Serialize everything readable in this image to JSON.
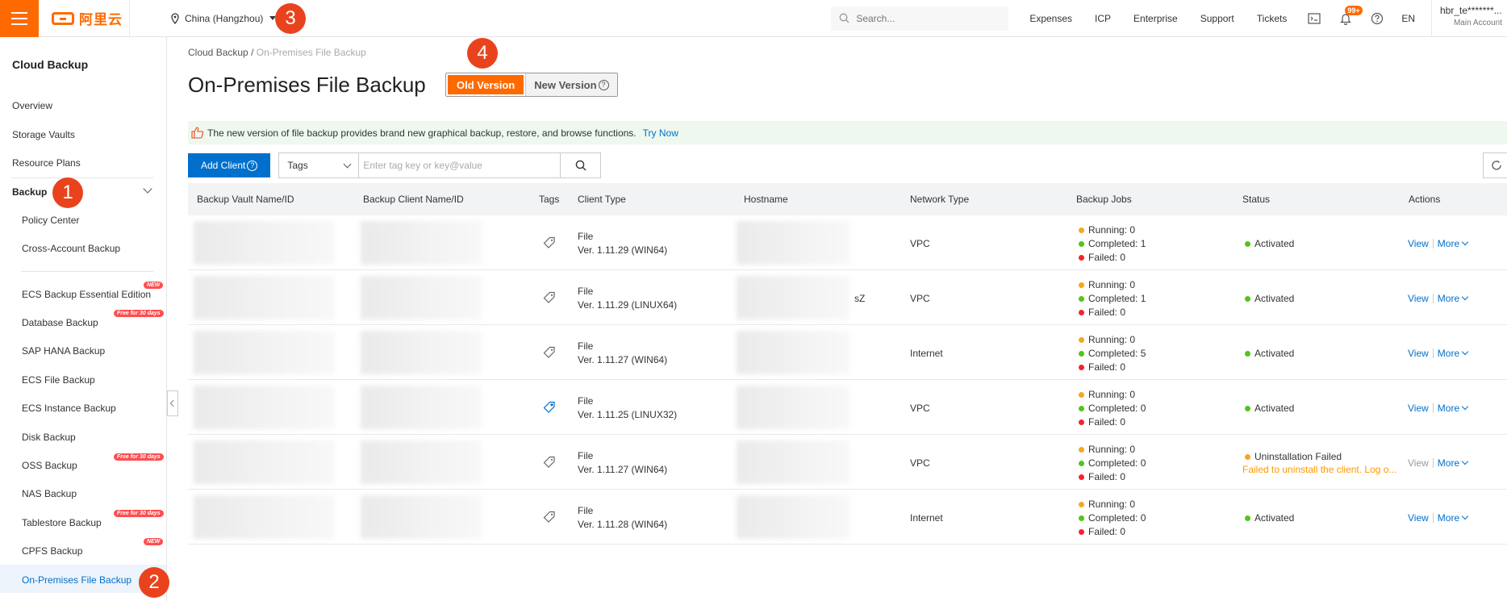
{
  "topbar": {
    "logo_text": "阿里云",
    "region": "China (Hangzhou)",
    "search_placeholder": "Search...",
    "links": [
      "Expenses",
      "ICP",
      "Enterprise",
      "Support",
      "Tickets"
    ],
    "notification_badge": "99+",
    "language": "EN",
    "account_name": "hbr_te*******...",
    "account_type": "Main Account"
  },
  "sidebar": {
    "title": "Cloud Backup",
    "items_top": [
      "Overview",
      "Storage Vaults",
      "Resource Plans"
    ],
    "backup_group": "Backup",
    "backup_sub": [
      "Policy Center",
      "Cross-Account Backup"
    ],
    "products": [
      {
        "label": "ECS Backup Essential Edition",
        "badge": "NEW"
      },
      {
        "label": "Database Backup",
        "badge": "Free for 30 days"
      },
      {
        "label": "SAP HANA Backup",
        "badge": ""
      },
      {
        "label": "ECS File Backup",
        "badge": ""
      },
      {
        "label": "ECS Instance Backup",
        "badge": ""
      },
      {
        "label": "Disk Backup",
        "badge": ""
      },
      {
        "label": "OSS Backup",
        "badge": "Free for 30 days"
      },
      {
        "label": "NAS Backup",
        "badge": ""
      },
      {
        "label": "Tablestore Backup",
        "badge": "Free for 30 days"
      },
      {
        "label": "CPFS Backup",
        "badge": "NEW"
      },
      {
        "label": "On-Premises File Backup",
        "badge": ""
      }
    ],
    "active": "On-Premises File Backup"
  },
  "steps": [
    "1",
    "2",
    "3",
    "4"
  ],
  "main": {
    "breadcrumb_root": "Cloud Backup",
    "breadcrumb_sep": "/",
    "breadcrumb_current": "On-Premises File Backup",
    "title": "On-Premises File Backup",
    "old_version": "Old Version",
    "new_version": "New Version",
    "notice": "The new version of file backup provides brand new graphical backup, restore, and browse functions.",
    "notice_link": "Try Now",
    "add_client": "Add Client",
    "tags_label": "Tags",
    "tag_placeholder": "Enter tag key or key@value"
  },
  "table": {
    "columns": [
      "Backup Vault Name/ID",
      "Backup Client Name/ID",
      "Tags",
      "Client Type",
      "Hostname",
      "Network Type",
      "Backup Jobs",
      "Status",
      "Actions"
    ],
    "job_labels": {
      "running": "Running:",
      "completed": "Completed:",
      "failed": "Failed:"
    },
    "view_label": "View",
    "more_label": "More",
    "rows": [
      {
        "type": "File",
        "version": "Ver. 1.11.29 (WIN64)",
        "hostname_suffix": "",
        "network": "VPC",
        "running": "0",
        "completed": "1",
        "failed": "0",
        "status": "Activated",
        "status_detail": "",
        "view_enabled": true
      },
      {
        "type": "File",
        "version": "Ver. 1.11.29 (LINUX64)",
        "hostname_suffix": "sZ",
        "network": "VPC",
        "running": "0",
        "completed": "1",
        "failed": "0",
        "status": "Activated",
        "status_detail": "",
        "view_enabled": true
      },
      {
        "type": "File",
        "version": "Ver. 1.11.27 (WIN64)",
        "hostname_suffix": "",
        "network": "Internet",
        "running": "0",
        "completed": "5",
        "failed": "0",
        "status": "Activated",
        "status_detail": "",
        "view_enabled": true
      },
      {
        "type": "File",
        "version": "Ver. 1.11.25 (LINUX32)",
        "hostname_suffix": "",
        "network": "VPC",
        "running": "0",
        "completed": "0",
        "failed": "0",
        "status": "Activated",
        "status_detail": "",
        "view_enabled": true
      },
      {
        "type": "File",
        "version": "Ver. 1.11.27 (WIN64)",
        "hostname_suffix": "",
        "network": "VPC",
        "running": "0",
        "completed": "0",
        "failed": "0",
        "status": "Uninstallation Failed",
        "status_detail": "Failed to uninstall the client. Log o...",
        "view_enabled": false
      },
      {
        "type": "File",
        "version": "Ver. 1.11.28 (WIN64)",
        "hostname_suffix": "",
        "network": "Internet",
        "running": "0",
        "completed": "0",
        "failed": "0",
        "status": "Activated",
        "status_detail": "",
        "view_enabled": true
      }
    ]
  },
  "colors": {
    "accent": "#ff6a00",
    "link": "#0070cc",
    "running": "#f5a623",
    "completed": "#52c41a",
    "failed": "#f5222d",
    "warning": "#ff9900",
    "step": "#e9431e"
  }
}
